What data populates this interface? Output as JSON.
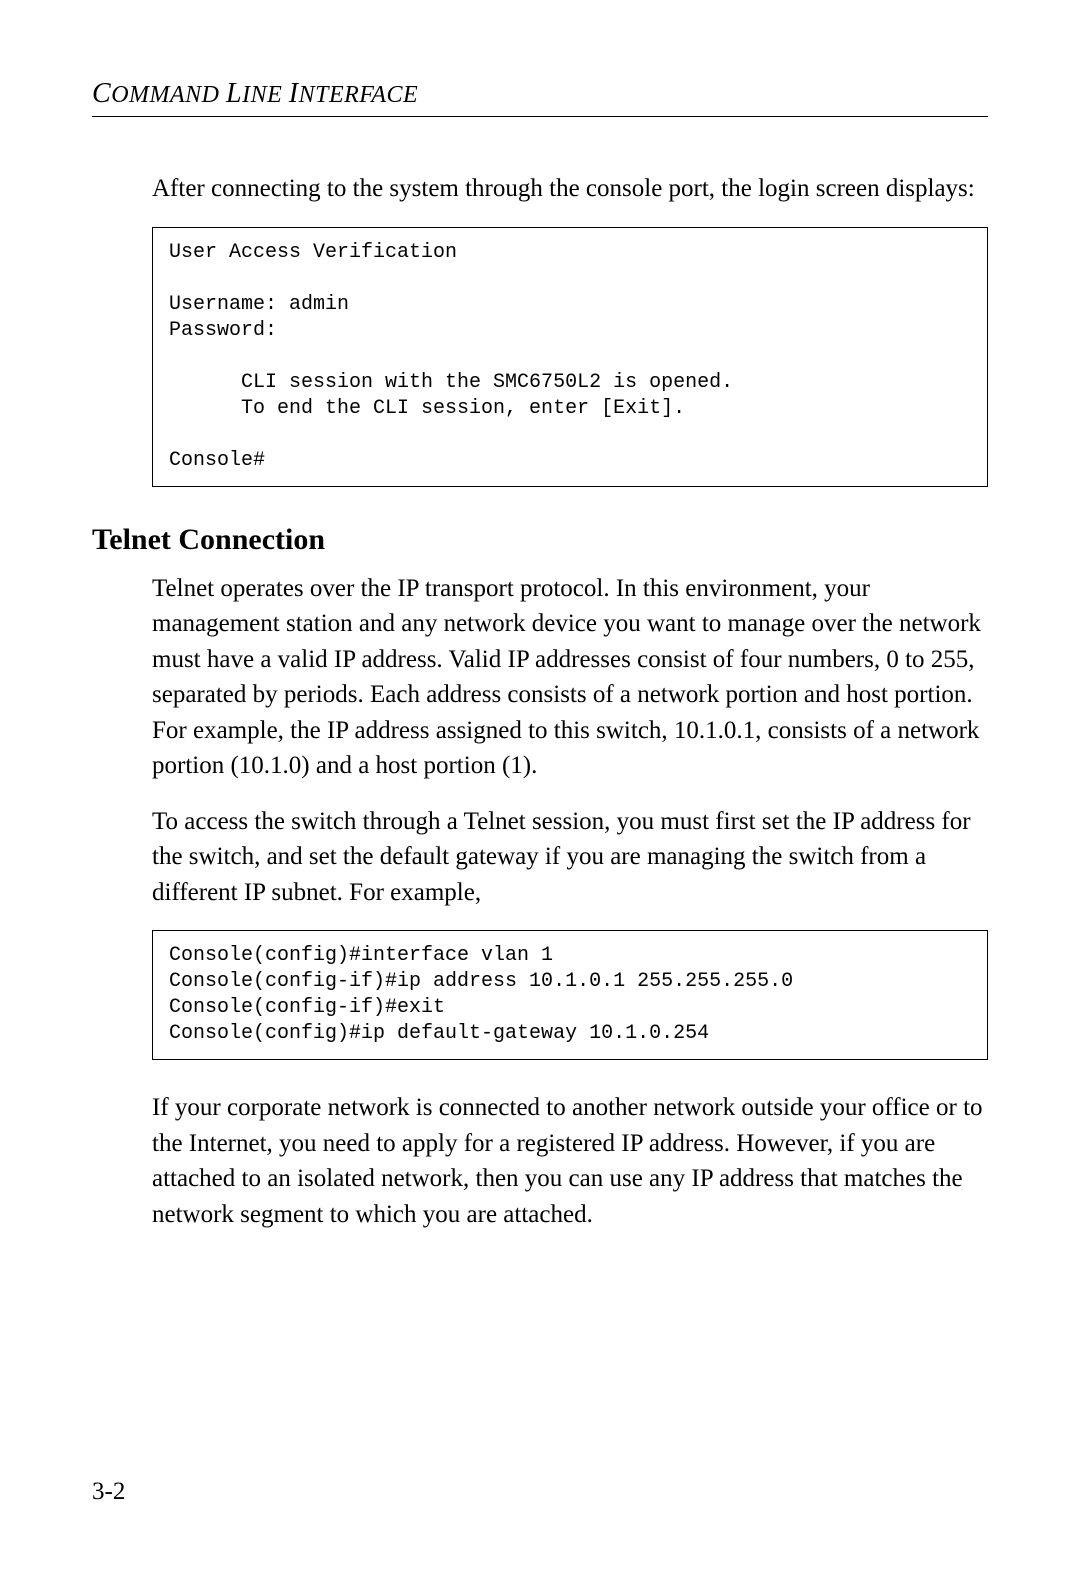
{
  "header": {
    "running_title_html": "C<span class=\"cap\"></span>OMMAND L<span class=\"cap\"></span>INE I<span class=\"cap\"></span>NTERFACE",
    "running_title_plain": "COMMAND LINE INTERFACE"
  },
  "body": {
    "para1": "After connecting to the system through the console port, the login screen displays:",
    "code1": "User Access Verification\n\nUsername: admin\nPassword:\n\n      CLI session with the SMC6750L2 is opened.\n      To end the CLI session, enter [Exit].\n\nConsole#",
    "subheading1": "Telnet Connection",
    "para2": "Telnet operates over the IP transport protocol. In this environment, your management station and any network device you want to manage over the network must have a valid IP address. Valid IP addresses consist of four numbers, 0 to 255, separated by periods. Each address consists of a network portion and host portion. For example, the IP address assigned to this switch, 10.1.0.1, consists of a network portion (10.1.0) and a host portion (1).",
    "para3": "To access the switch through a Telnet session, you must first set the IP address for the switch, and set the default gateway if you are managing the switch from a different IP subnet. For example,",
    "code2": "Console(config)#interface vlan 1\nConsole(config-if)#ip address 10.1.0.1 255.255.255.0\nConsole(config-if)#exit\nConsole(config)#ip default-gateway 10.1.0.254",
    "para4": "If your corporate network is connected to another network outside your office or to the Internet, you need to apply for a registered IP address. However, if you are attached to an isolated network, then you can use any IP address that matches the network segment to which you are attached."
  },
  "page_number": "3-2"
}
